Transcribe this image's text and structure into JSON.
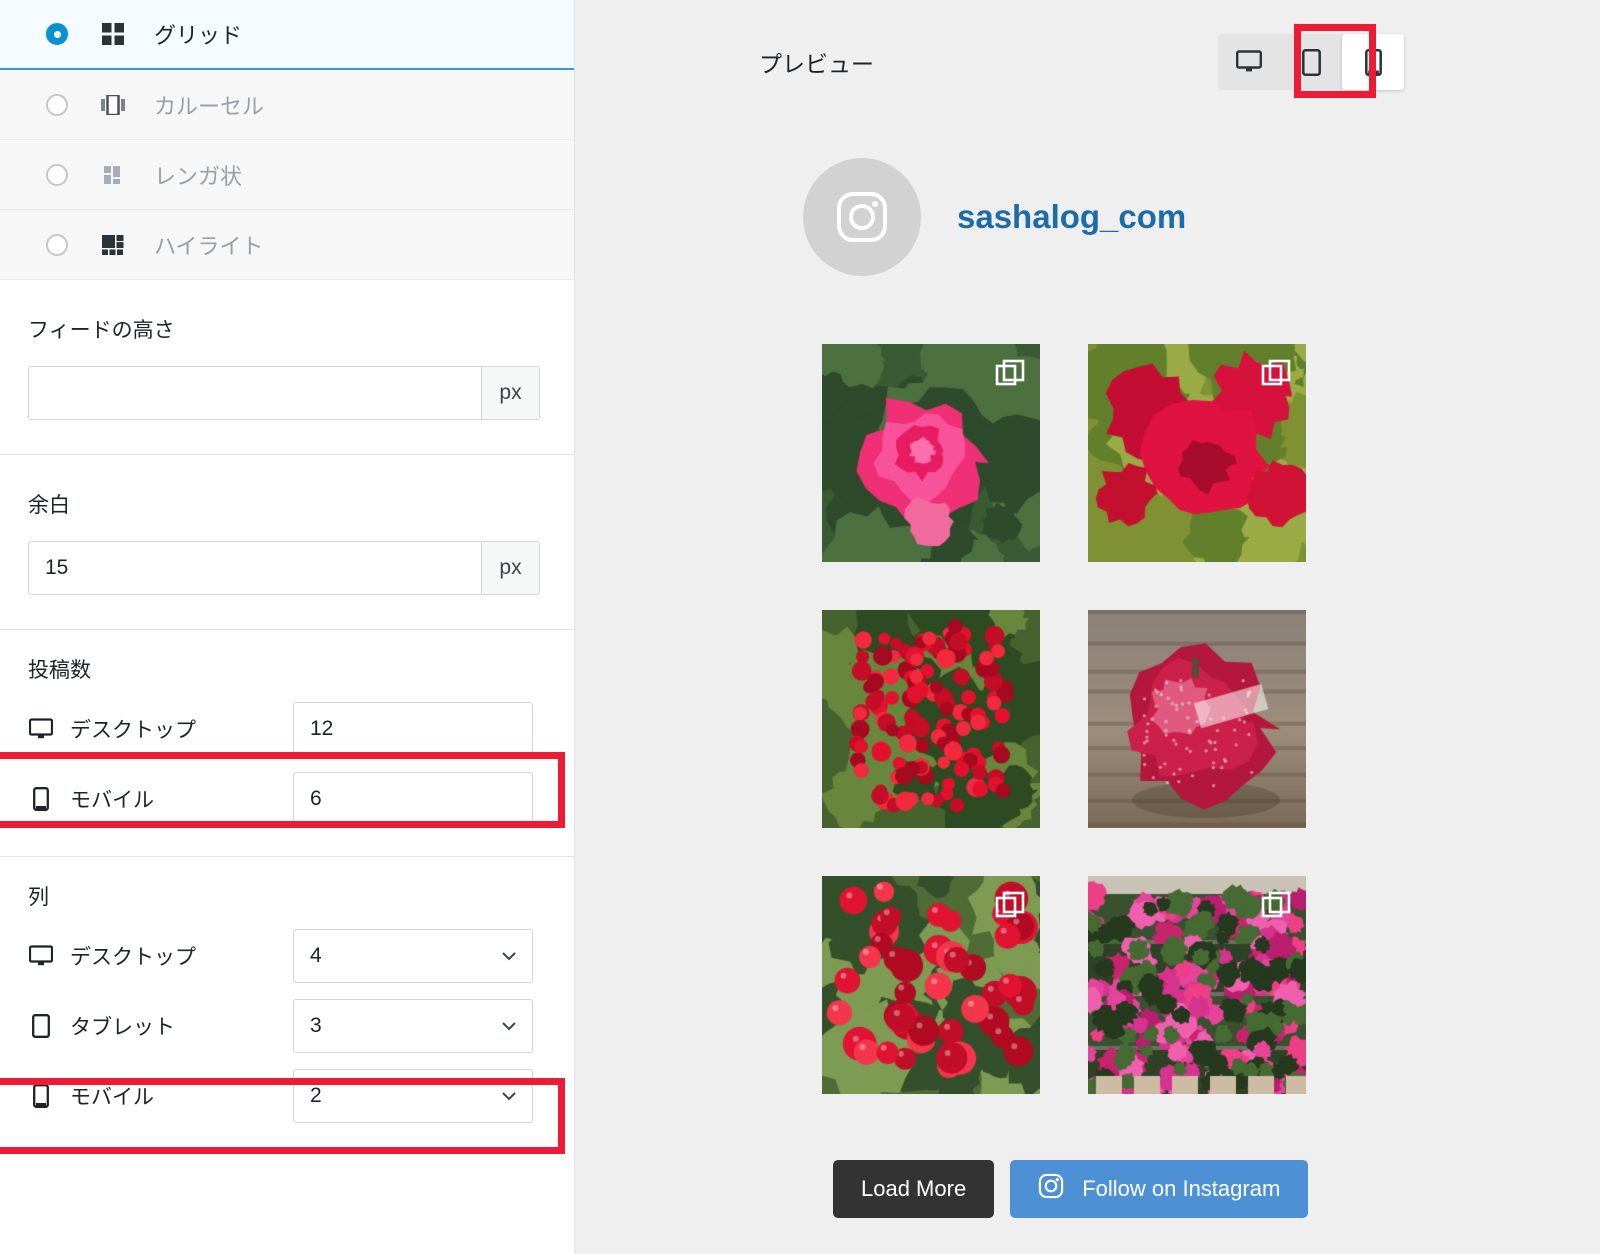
{
  "sidebar": {
    "layout_options": [
      {
        "label": "グリッド",
        "icon": "grid-icon",
        "selected": true
      },
      {
        "label": "カルーセル",
        "icon": "carousel-icon",
        "selected": false
      },
      {
        "label": "レンガ状",
        "icon": "masonry-icon",
        "selected": false
      },
      {
        "label": "ハイライト",
        "icon": "highlight-icon",
        "selected": false
      }
    ],
    "feed_height": {
      "label": "フィードの高さ",
      "value": "",
      "placeholder": "",
      "unit": "px"
    },
    "padding": {
      "label": "余白",
      "value": "15",
      "unit": "px"
    },
    "post_count": {
      "title": "投稿数",
      "rows": [
        {
          "label": "デスクトップ",
          "icon": "desktop-icon",
          "value": "12",
          "type": "number",
          "highlighted": false
        },
        {
          "label": "モバイル",
          "icon": "mobile-icon",
          "value": "6",
          "type": "number",
          "highlighted": true
        }
      ]
    },
    "columns": {
      "title": "列",
      "rows": [
        {
          "label": "デスクトップ",
          "icon": "desktop-icon",
          "value": "4",
          "type": "select",
          "highlighted": false
        },
        {
          "label": "タブレット",
          "icon": "tablet-icon",
          "value": "3",
          "type": "select",
          "highlighted": false
        },
        {
          "label": "モバイル",
          "icon": "mobile-icon",
          "value": "2",
          "type": "select",
          "highlighted": true
        }
      ]
    }
  },
  "preview": {
    "title": "プレビュー",
    "device_toggle": [
      {
        "name": "desktop-icon",
        "label": "Desktop",
        "active": false
      },
      {
        "name": "tablet-icon",
        "label": "Tablet",
        "active": false
      },
      {
        "name": "mobile-icon",
        "label": "Mobile",
        "active": true
      }
    ],
    "account": {
      "name": "sashalog_com",
      "avatar_icon": "instagram-icon"
    },
    "posts": [
      {
        "alt": "pink camellia flower",
        "multi": true
      },
      {
        "alt": "red chrysanthemum flowers",
        "multi": true
      },
      {
        "alt": "red nandina berries",
        "multi": false
      },
      {
        "alt": "red apple with label",
        "multi": false
      },
      {
        "alt": "red cotoneaster berries",
        "multi": true
      },
      {
        "alt": "pink cyclamen flowers in greenhouse",
        "multi": true
      }
    ],
    "buttons": {
      "load_more": "Load More",
      "follow": "Follow on Instagram",
      "follow_icon": "instagram-icon"
    }
  },
  "colors": {
    "accent_blue": "#0a91d2",
    "link_blue": "#1b6ca8",
    "highlight_red": "#ed1b35",
    "follow_button": "#4d91d4",
    "load_more_button": "#333333",
    "preview_bg": "#efefef"
  }
}
